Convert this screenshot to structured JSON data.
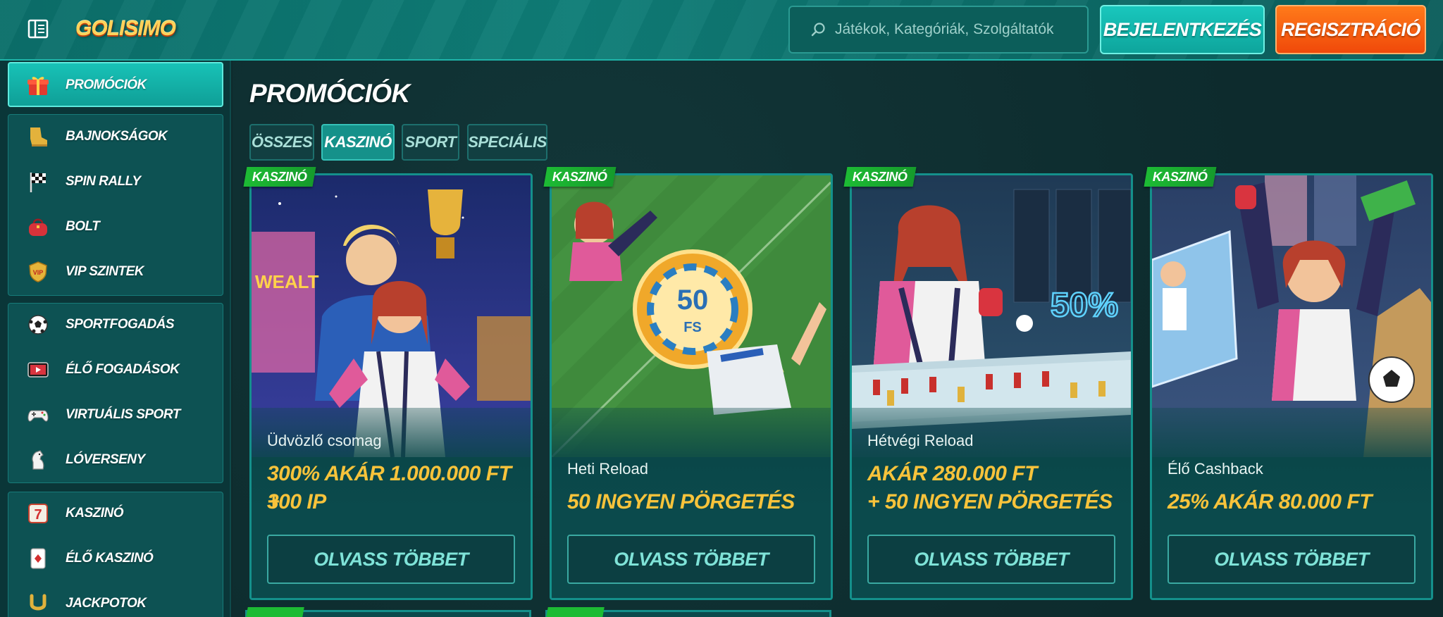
{
  "header": {
    "logo_text": "GOLISIMO",
    "search_placeholder": "Játékok, Kategóriák, Szolgáltatók",
    "login_label": "BEJELENTKEZÉS",
    "register_label": "REGISZTRÁCIÓ"
  },
  "sidebar": {
    "active": {
      "label": "PROMÓCIÓK",
      "icon": "gift-icon"
    },
    "group1": [
      {
        "label": "BAJNOKSÁGOK",
        "icon": "trophy-boot-icon"
      },
      {
        "label": "SPIN RALLY",
        "icon": "checkered-flag-icon"
      },
      {
        "label": "BOLT",
        "icon": "bag-icon"
      },
      {
        "label": "VIP SZINTEK",
        "icon": "vip-shield-icon"
      }
    ],
    "group2": [
      {
        "label": "SPORTFOGADÁS",
        "icon": "soccer-ball-icon"
      },
      {
        "label": "ÉLŐ FOGADÁSOK",
        "icon": "live-tv-icon"
      },
      {
        "label": "VIRTUÁLIS SPORT",
        "icon": "gamepad-icon"
      },
      {
        "label": "LÓVERSENY",
        "icon": "horse-icon"
      }
    ],
    "group3": [
      {
        "label": "KASZINÓ",
        "icon": "slot-seven-icon"
      },
      {
        "label": "ÉLŐ KASZINÓ",
        "icon": "playing-card-icon"
      },
      {
        "label": "JACKPOTOK",
        "icon": "horseshoe-icon"
      }
    ]
  },
  "main": {
    "title": "PROMÓCIÓK",
    "tabs": [
      {
        "label": "ÖSSZES",
        "active": false
      },
      {
        "label": "KASZINÓ",
        "active": true
      },
      {
        "label": "SPORT",
        "active": false
      },
      {
        "label": "SPECIÁLIS",
        "active": false
      }
    ],
    "cards": [
      {
        "badge": "KASZINÓ",
        "subtitle": "Üdvözlő csomag",
        "title_line1": "300% AKÁR 1.000.000 FT +",
        "title_line2": "300 IP",
        "button": "OLVASS TÖBBET"
      },
      {
        "badge": "KASZINÓ",
        "subtitle": "Heti Reload",
        "title_line1": "50 INGYEN PÖRGETÉS",
        "title_line2": "",
        "button": "OLVASS TÖBBET",
        "chip_text": "50",
        "chip_sub": "FS"
      },
      {
        "badge": "KASZINÓ",
        "subtitle": "Hétvégi Reload",
        "title_line1": "AKÁR 280.000 FT",
        "title_line2": "+ 50 INGYEN PÖRGETÉS",
        "button": "OLVASS TÖBBET",
        "promo_text": "50%"
      },
      {
        "badge": "KASZINÓ",
        "subtitle": "Élő Cashback",
        "title_line1": "25% AKÁR 80.000 FT",
        "title_line2": "",
        "button": "OLVASS TÖBBET"
      }
    ]
  },
  "colors": {
    "header_bg": "#0b6f6a",
    "accent_teal": "#19c7bd",
    "accent_orange": "#f0490a",
    "gold_text": "#f7c33b",
    "badge_green": "#1dbb34"
  }
}
